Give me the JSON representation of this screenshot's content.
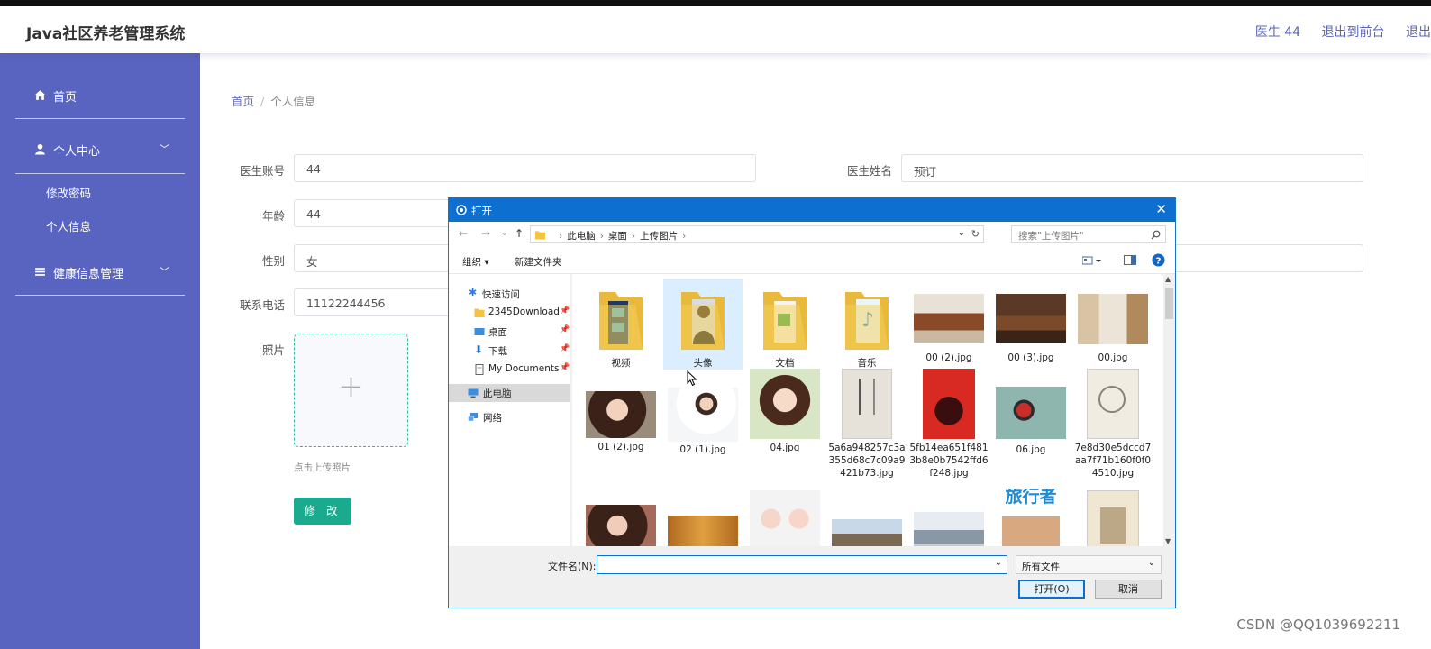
{
  "app": {
    "title": "Java社区养老管理系统"
  },
  "header_links": [
    "医生 44",
    "退出到前台",
    "退出"
  ],
  "sidebar": {
    "home": "首页",
    "personal_center": "个人中心",
    "change_password": "修改密码",
    "personal_info": "个人信息",
    "health_mgmt": "健康信息管理"
  },
  "breadcrumb": {
    "home": "首页",
    "sep": "/",
    "current": "个人信息"
  },
  "form": {
    "account_label": "医生账号",
    "account_value": "44",
    "name_label": "医生姓名",
    "name_value": "预订",
    "age_label": "年龄",
    "age_value": "44",
    "gender_label": "性别",
    "gender_value": "女",
    "phone_label": "联系电话",
    "phone_value": "11122244456",
    "photo_label": "照片",
    "upload_tip": "点击上传照片",
    "submit_label": "修 改"
  },
  "dialog": {
    "title": "打开",
    "path": [
      "此电脑",
      "桌面",
      "上传图片"
    ],
    "search_placeholder": "搜索\"上传图片\"",
    "organize": "组织 ▾",
    "new_folder": "新建文件夹",
    "nav": {
      "quick_access": "快速访问",
      "downloads_2345": "2345Download",
      "desktop": "桌面",
      "downloads": "下载",
      "my_documents": "My Documents",
      "this_pc": "此电脑",
      "network": "网络"
    },
    "files_row1": [
      "视频",
      "头像",
      "文档",
      "音乐",
      "00 (2).jpg",
      "00 (3).jpg",
      "00.jpg"
    ],
    "files_row2": [
      "01 (2).jpg",
      "02 (1).jpg",
      "04.jpg",
      "5a6a948257c3a355d68c7c09a9421b73.jpg",
      "5fb14ea651f4813b8e0b7542ffd6f248.jpg",
      "06.jpg",
      "7e8d30e5dccd7aa7f71b160f0f04510.jpg"
    ],
    "thumb_text_travel": "旅行者",
    "filename_label": "文件名(N):",
    "filetype": "所有文件",
    "open_button": "打开(O)",
    "cancel_button": "取消"
  },
  "watermark": "CSDN @QQ1039692211",
  "colors": {
    "sidebar": "#5864c0",
    "accent": "#1aaa8d",
    "dialog_blue": "#0d6fd0"
  }
}
